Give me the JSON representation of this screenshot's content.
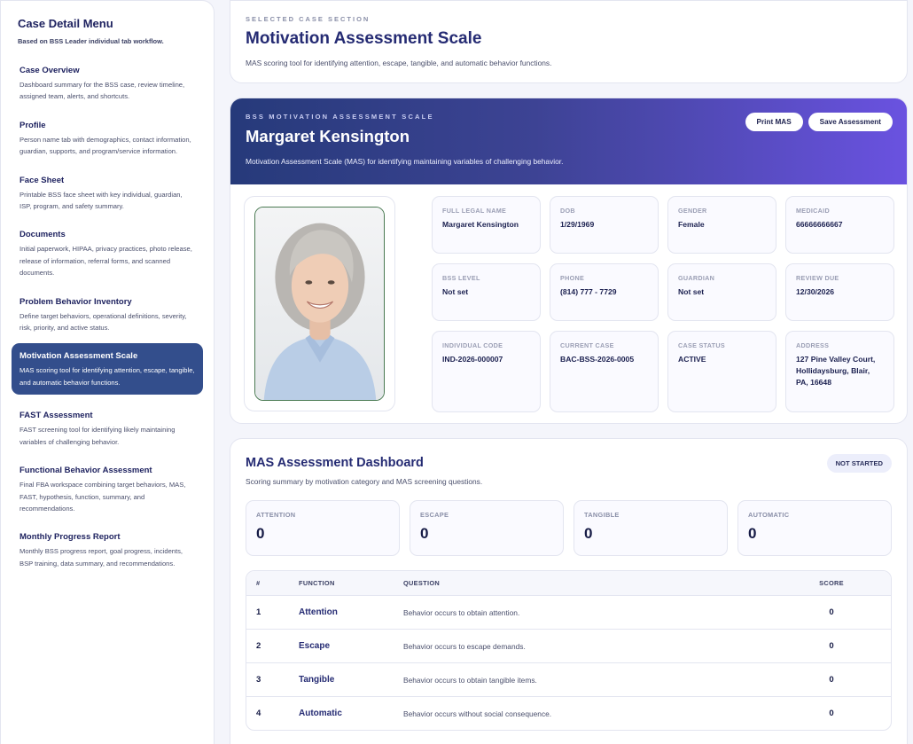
{
  "sidebar": {
    "title": "Case Detail Menu",
    "subtitle": "Based on BSS Leader individual tab workflow.",
    "items": [
      {
        "label": "Case Overview",
        "desc": "Dashboard summary for the BSS case, review timeline, assigned team, alerts, and shortcuts."
      },
      {
        "label": "Profile",
        "desc": "Person name tab with demographics, contact information, guardian, supports, and program/service information."
      },
      {
        "label": "Face Sheet",
        "desc": "Printable BSS face sheet with key individual, guardian, ISP, program, and safety summary."
      },
      {
        "label": "Documents",
        "desc": "Initial paperwork, HIPAA, privacy practices, photo release, release of information, referral forms, and scanned documents."
      },
      {
        "label": "Problem Behavior Inventory",
        "desc": "Define target behaviors, operational definitions, severity, risk, priority, and active status."
      },
      {
        "label": "Motivation Assessment Scale",
        "desc": "MAS scoring tool for identifying attention, escape, tangible, and automatic behavior functions."
      },
      {
        "label": "FAST Assessment",
        "desc": "FAST screening tool for identifying likely maintaining variables of challenging behavior."
      },
      {
        "label": "Functional Behavior Assessment",
        "desc": "Final FBA workspace combining target behaviors, MAS, FAST, hypothesis, function, summary, and recommendations."
      },
      {
        "label": "Monthly Progress Report",
        "desc": "Monthly BSS progress report, goal progress, incidents, BSP training, data summary, and recommendations."
      }
    ]
  },
  "section": {
    "eyebrow": "SELECTED CASE SECTION",
    "title": "Motivation Assessment Scale",
    "desc": "MAS scoring tool for identifying attention, escape, tangible, and automatic behavior functions."
  },
  "banner": {
    "eyebrow": "BSS MOTIVATION ASSESSMENT SCALE",
    "name": "Margaret Kensington",
    "desc": "Motivation Assessment Scale (MAS) for identifying maintaining variables of challenging behavior.",
    "print_label": "Print MAS",
    "save_label": "Save Assessment"
  },
  "info": [
    {
      "label": "FULL LEGAL NAME",
      "value": "Margaret Kensington"
    },
    {
      "label": "DOB",
      "value": "1/29/1969"
    },
    {
      "label": "GENDER",
      "value": "Female"
    },
    {
      "label": "MEDICAID",
      "value": "66666666667"
    },
    {
      "label": "BSS LEVEL",
      "value": "Not set"
    },
    {
      "label": "PHONE",
      "value": "(814) 777 - 7729"
    },
    {
      "label": "GUARDIAN",
      "value": "Not set"
    },
    {
      "label": "REVIEW DUE",
      "value": "12/30/2026"
    },
    {
      "label": "INDIVIDUAL CODE",
      "value": "IND-2026-000007"
    },
    {
      "label": "CURRENT CASE",
      "value": "BAC-BSS-2026-0005"
    },
    {
      "label": "CASE STATUS",
      "value": "ACTIVE"
    },
    {
      "label": "ADDRESS",
      "value": "127 Pine Valley Court, Hollidaysburg, Blair, PA, 16648"
    }
  ],
  "dashboard": {
    "title": "MAS Assessment Dashboard",
    "subtitle": "Scoring summary by motivation category and MAS screening questions.",
    "status": "NOT STARTED",
    "scores": [
      {
        "label": "ATTENTION",
        "value": "0"
      },
      {
        "label": "ESCAPE",
        "value": "0"
      },
      {
        "label": "TANGIBLE",
        "value": "0"
      },
      {
        "label": "AUTOMATIC",
        "value": "0"
      }
    ],
    "table": {
      "headers": [
        "#",
        "FUNCTION",
        "QUESTION",
        "SCORE"
      ],
      "rows": [
        {
          "num": "1",
          "function": "Attention",
          "question": "Behavior occurs to obtain attention.",
          "score": "0"
        },
        {
          "num": "2",
          "function": "Escape",
          "question": "Behavior occurs to escape demands.",
          "score": "0"
        },
        {
          "num": "3",
          "function": "Tangible",
          "question": "Behavior occurs to obtain tangible items.",
          "score": "0"
        },
        {
          "num": "4",
          "function": "Automatic",
          "question": "Behavior occurs without social consequence.",
          "score": "0"
        }
      ]
    }
  }
}
